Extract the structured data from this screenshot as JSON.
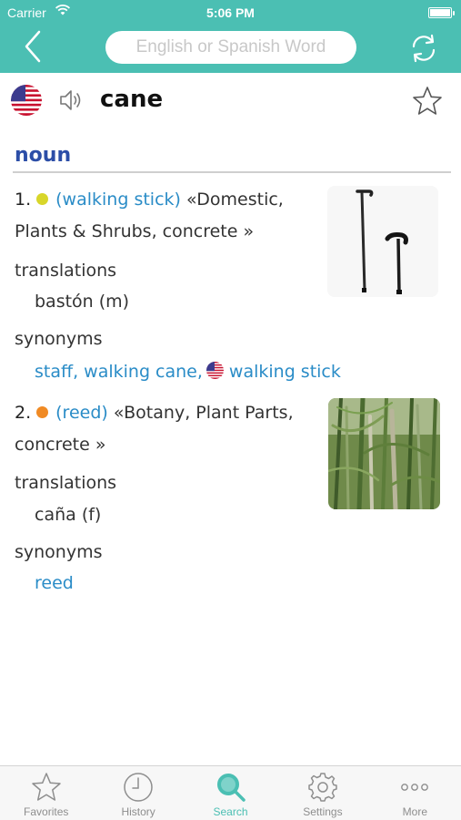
{
  "status_bar": {
    "carrier": "Carrier",
    "time": "5:06 PM"
  },
  "search": {
    "placeholder": "English or Spanish Word",
    "value": ""
  },
  "word": {
    "headword": "cane",
    "language_flag": "us-flag-icon"
  },
  "entry": {
    "part_of_speech": "noun",
    "senses": [
      {
        "number": "1.",
        "dot_color": "#d8d62a",
        "gloss": "(walking stick)",
        "domain_line1": "«Domestic,",
        "domain_line2": "Plants & Shrubs, concrete »",
        "translations_label": "translations",
        "translation": "bastón (m)",
        "synonyms_label": "synonyms",
        "synonyms_prefix": "staff, walking cane,",
        "synonym_english": "walking stick",
        "image": "walking-cane-image"
      },
      {
        "number": "2.",
        "dot_color": "#f08a24",
        "gloss": "(reed)",
        "domain_line1": "«Botany, Plant Parts,",
        "domain_line2": "concrete »",
        "translations_label": "translations",
        "translation": "caña (f)",
        "synonyms_label": "synonyms",
        "synonyms_prefix": "reed",
        "image": "reed-plant-image"
      }
    ]
  },
  "tabs": [
    {
      "label": "Favorites",
      "icon": "star-icon"
    },
    {
      "label": "History",
      "icon": "clock-icon"
    },
    {
      "label": "Search",
      "icon": "magnifier-icon",
      "active": true
    },
    {
      "label": "Settings",
      "icon": "gear-icon"
    },
    {
      "label": "More",
      "icon": "ellipsis-icon"
    }
  ],
  "colors": {
    "accent": "#4bbfb3",
    "link": "#2a8cc7",
    "pos": "#2c4ea7"
  }
}
